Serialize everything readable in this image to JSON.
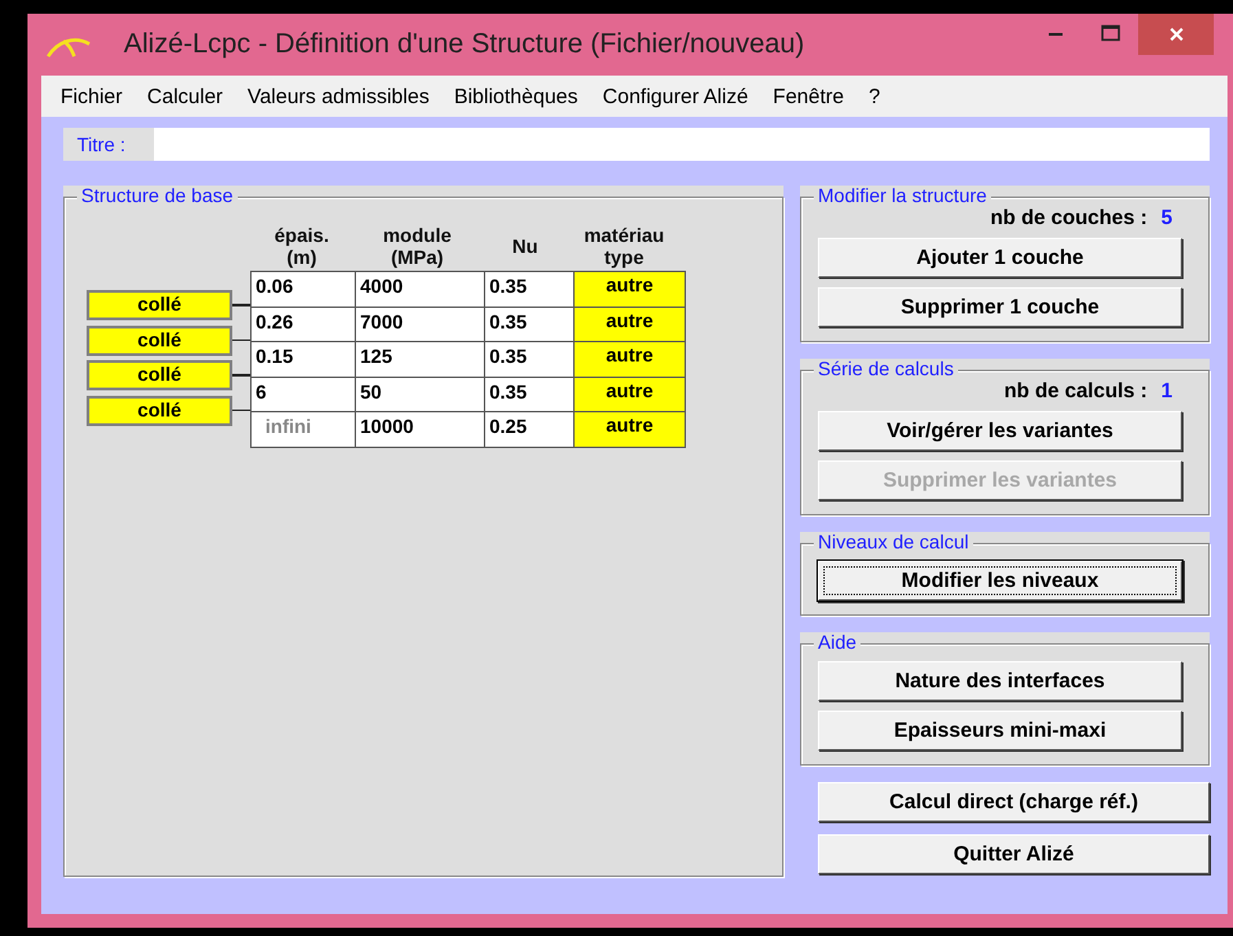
{
  "window": {
    "title": "Alizé-Lcpc - Définition d'une Structure (Fichier/nouveau)"
  },
  "menu": [
    "Fichier",
    "Calculer",
    "Valeurs admissibles",
    "Bibliothèques",
    "Configurer Alizé",
    "Fenêtre",
    "?"
  ],
  "title_field": {
    "label": "Titre :"
  },
  "structure": {
    "legend": "Structure de base",
    "columns": [
      {
        "lines": [
          "épais.",
          "(m)"
        ]
      },
      {
        "lines": [
          "module",
          "(MPa)"
        ]
      },
      {
        "lines": [
          "Nu"
        ]
      },
      {
        "lines": [
          "matériau",
          "type"
        ]
      }
    ],
    "rows": [
      {
        "thickness": "0.06",
        "thickness_disabled": false,
        "modulus": "4000",
        "nu": "0.35",
        "material": "autre"
      },
      {
        "thickness": "0.26",
        "thickness_disabled": false,
        "modulus": "7000",
        "nu": "0.35",
        "material": "autre"
      },
      {
        "thickness": "0.15",
        "thickness_disabled": false,
        "modulus": "125",
        "nu": "0.35",
        "material": "autre"
      },
      {
        "thickness": "6",
        "thickness_disabled": false,
        "modulus": "50",
        "nu": "0.35",
        "material": "autre"
      },
      {
        "thickness": "infini",
        "thickness_disabled": true,
        "modulus": "10000",
        "nu": "0.25",
        "material": "autre"
      }
    ],
    "interfaces": [
      "collé",
      "collé",
      "collé",
      "collé"
    ]
  },
  "groups": [
    {
      "legend": "Modifier la structure",
      "count_label": "nb de couches :",
      "count": "5",
      "buttons": [
        {
          "label": "Ajouter 1 couche",
          "disabled": false,
          "focused": false
        },
        {
          "label": "Supprimer 1 couche",
          "disabled": false,
          "focused": false
        }
      ]
    },
    {
      "legend": "Série de calculs",
      "count_label": "nb de calculs :",
      "count": "1",
      "buttons": [
        {
          "label": "Voir/gérer les variantes",
          "disabled": false,
          "focused": false
        },
        {
          "label": "Supprimer les variantes",
          "disabled": true,
          "focused": false
        }
      ]
    },
    {
      "legend": "Niveaux de calcul",
      "buttons": [
        {
          "label": "Modifier les niveaux",
          "disabled": false,
          "focused": true
        }
      ]
    },
    {
      "legend": "Aide",
      "buttons": [
        {
          "label": "Nature des interfaces",
          "disabled": false,
          "focused": false
        },
        {
          "label": "Epaisseurs mini-maxi",
          "disabled": false,
          "focused": false
        }
      ]
    }
  ],
  "bottom_buttons": [
    {
      "label": "Calcul direct (charge réf.)",
      "disabled": false,
      "focused": false
    },
    {
      "label": "Quitter Alizé",
      "disabled": false,
      "focused": false
    }
  ]
}
